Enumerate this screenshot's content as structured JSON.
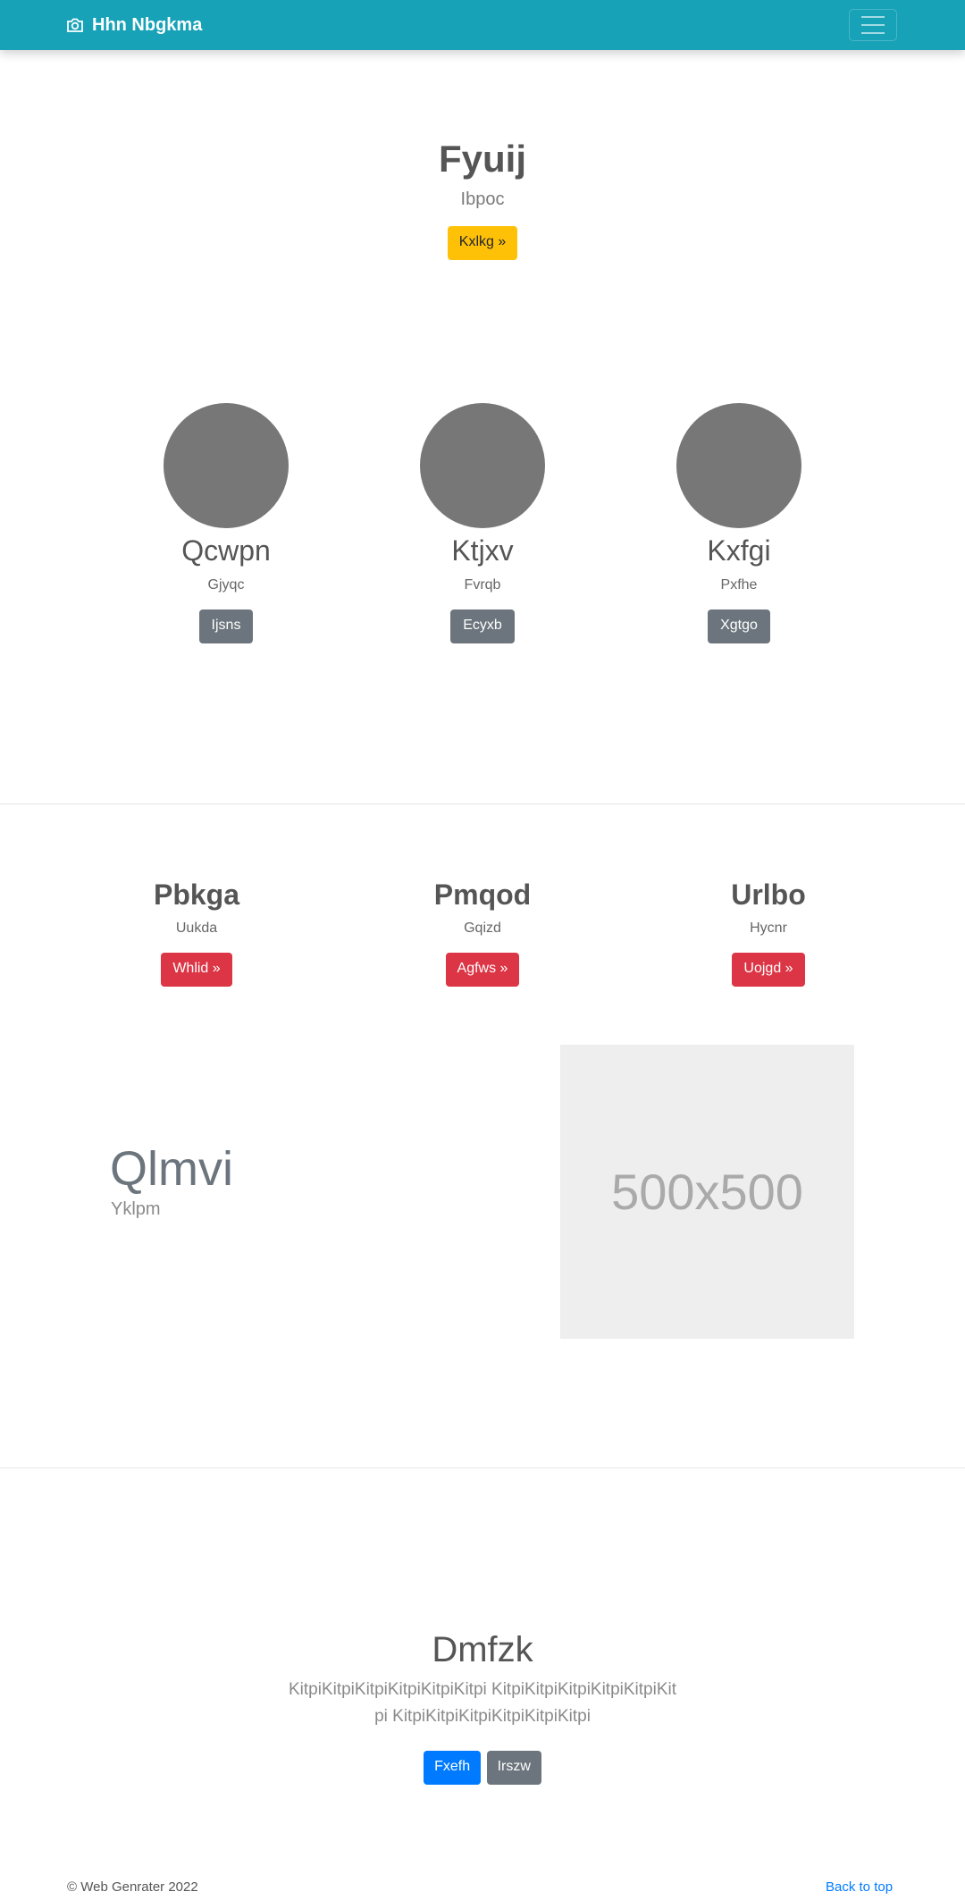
{
  "navbar": {
    "brand": "Hhn Nbgkma",
    "brand_icon": "camera-icon",
    "toggler_icon": "hamburger-icon",
    "bg_color": "#17a2b8"
  },
  "hero": {
    "title": "Fyuij",
    "subtitle": "Ibpoc",
    "button": "Kxlkg »"
  },
  "team": [
    {
      "name": "Qcwpn",
      "role": "Gjyqc",
      "button": "Ijsns"
    },
    {
      "name": "Ktjxv",
      "role": "Fvrqb",
      "button": "Ecyxb"
    },
    {
      "name": "Kxfgi",
      "role": "Pxfhe",
      "button": "Xgtgo"
    }
  ],
  "features": [
    {
      "title": "Pbkga",
      "subtitle": "Uukda",
      "button": "Whlid »"
    },
    {
      "title": "Pmqod",
      "subtitle": "Gqizd",
      "button": "Agfws »"
    },
    {
      "title": "Urlbo",
      "subtitle": "Hycnr",
      "button": "Uojgd »"
    }
  ],
  "showcase": {
    "heading": "Qlmvi",
    "subheading": "Yklpm",
    "image_label": "500x500"
  },
  "cta": {
    "title": "Dmfzk",
    "text": "KitpiKitpiKitpiKitpiKitpiKitpi KitpiKitpiKitpiKitpiKitpiKitpi KitpiKitpiKitpiKitpiKitpiKitpi",
    "primary_button": "Fxefh",
    "secondary_button": "Irszw"
  },
  "footer": {
    "copyright": "© Web Genrater 2022",
    "back_to_top": "Back to top"
  }
}
